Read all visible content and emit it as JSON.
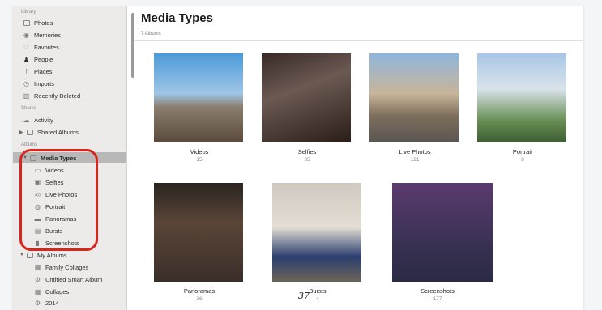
{
  "sidebar": {
    "library_heading": "Library",
    "library_items": [
      {
        "label": "Photos",
        "icon": "photos-icon"
      },
      {
        "label": "Memories",
        "icon": "memories-icon"
      },
      {
        "label": "Favorites",
        "icon": "heart-icon"
      },
      {
        "label": "People",
        "icon": "person-icon"
      },
      {
        "label": "Places",
        "icon": "pin-icon"
      },
      {
        "label": "Imports",
        "icon": "clock-icon"
      },
      {
        "label": "Recently Deleted",
        "icon": "trash-icon"
      }
    ],
    "shared_heading": "Shared",
    "shared_items": [
      {
        "label": "Activity",
        "icon": "cloud-icon"
      },
      {
        "label": "Shared Albums",
        "icon": "folder-icon"
      }
    ],
    "albums_heading": "Albums",
    "media_types_label": "Media Types",
    "media_type_items": [
      {
        "label": "Videos",
        "icon": "video-icon"
      },
      {
        "label": "Selfies",
        "icon": "selfie-icon"
      },
      {
        "label": "Live Photos",
        "icon": "live-photo-icon"
      },
      {
        "label": "Portrait",
        "icon": "portrait-icon"
      },
      {
        "label": "Panoramas",
        "icon": "panorama-icon"
      },
      {
        "label": "Bursts",
        "icon": "bursts-icon"
      },
      {
        "label": "Screenshots",
        "icon": "screenshot-icon"
      }
    ],
    "my_albums_label": "My Albums",
    "my_album_items": [
      {
        "label": "Family Collages",
        "icon": "album-icon"
      },
      {
        "label": "Untitled Smart Album",
        "icon": "smart-album-icon"
      },
      {
        "label": "Collages",
        "icon": "album-icon"
      },
      {
        "label": "2014",
        "icon": "smart-album-icon"
      }
    ]
  },
  "main": {
    "title": "Media Types",
    "subtitle": "7 Albums",
    "tiles": [
      {
        "name": "Videos",
        "count": "15"
      },
      {
        "name": "Selfies",
        "count": "35"
      },
      {
        "name": "Live Photos",
        "count": "121"
      },
      {
        "name": "Portrait",
        "count": "8"
      },
      {
        "name": "Panoramas",
        "count": "36"
      },
      {
        "name": "Bursts",
        "count": "4"
      },
      {
        "name": "Screenshots",
        "count": "177"
      }
    ],
    "annotation": "37"
  },
  "colors": {
    "highlight": "#d9261c",
    "selected": "#b8b8b8",
    "sidebar": "#ecebe9"
  }
}
